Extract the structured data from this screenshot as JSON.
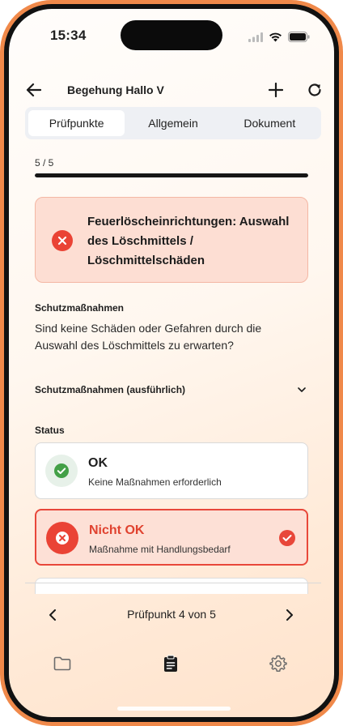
{
  "status_bar": {
    "time": "15:34",
    "icons": [
      "signal-icon",
      "wifi-icon",
      "battery-icon"
    ]
  },
  "app_bar": {
    "title": "Begehung Hallo V",
    "icons": [
      "back-arrow-icon",
      "plus-icon",
      "refresh-icon"
    ]
  },
  "tabs": [
    {
      "label": "Prüfpunkte",
      "active": true
    },
    {
      "label": "Allgemein",
      "active": false
    },
    {
      "label": "Dokument",
      "active": false
    }
  ],
  "progress": {
    "label": "5 / 5",
    "fraction": 1.0
  },
  "checkpoint": {
    "title": "Feuerlöscheinrichtungen: Auswahl des Löschmittels / Löschmittelschäden",
    "status_icon": "error-x-icon"
  },
  "measures": {
    "label": "Schutzmaßnahmen",
    "question": "Sind keine Schäden oder Gefahren durch die Auswahl des Löschmittels zu erwarten?",
    "expander_label": "Schutzmaßnahmen (ausführlich)"
  },
  "status": {
    "label": "Status",
    "options": [
      {
        "title": "OK",
        "subtitle": "Keine Maßnahmen erforderlich",
        "selected": false
      },
      {
        "title": "Nicht OK",
        "subtitle": "Maßnahme mit Handlungsbedarf",
        "selected": true
      }
    ]
  },
  "pager": {
    "label": "Prüfpunkt 4 von 5"
  },
  "bottom_nav": {
    "items": [
      "folder-icon",
      "clipboard-icon",
      "settings-gear-icon"
    ]
  },
  "colors": {
    "accent_orange": "#f0894a",
    "error_red": "#ea4335",
    "ok_green": "#43a047"
  }
}
